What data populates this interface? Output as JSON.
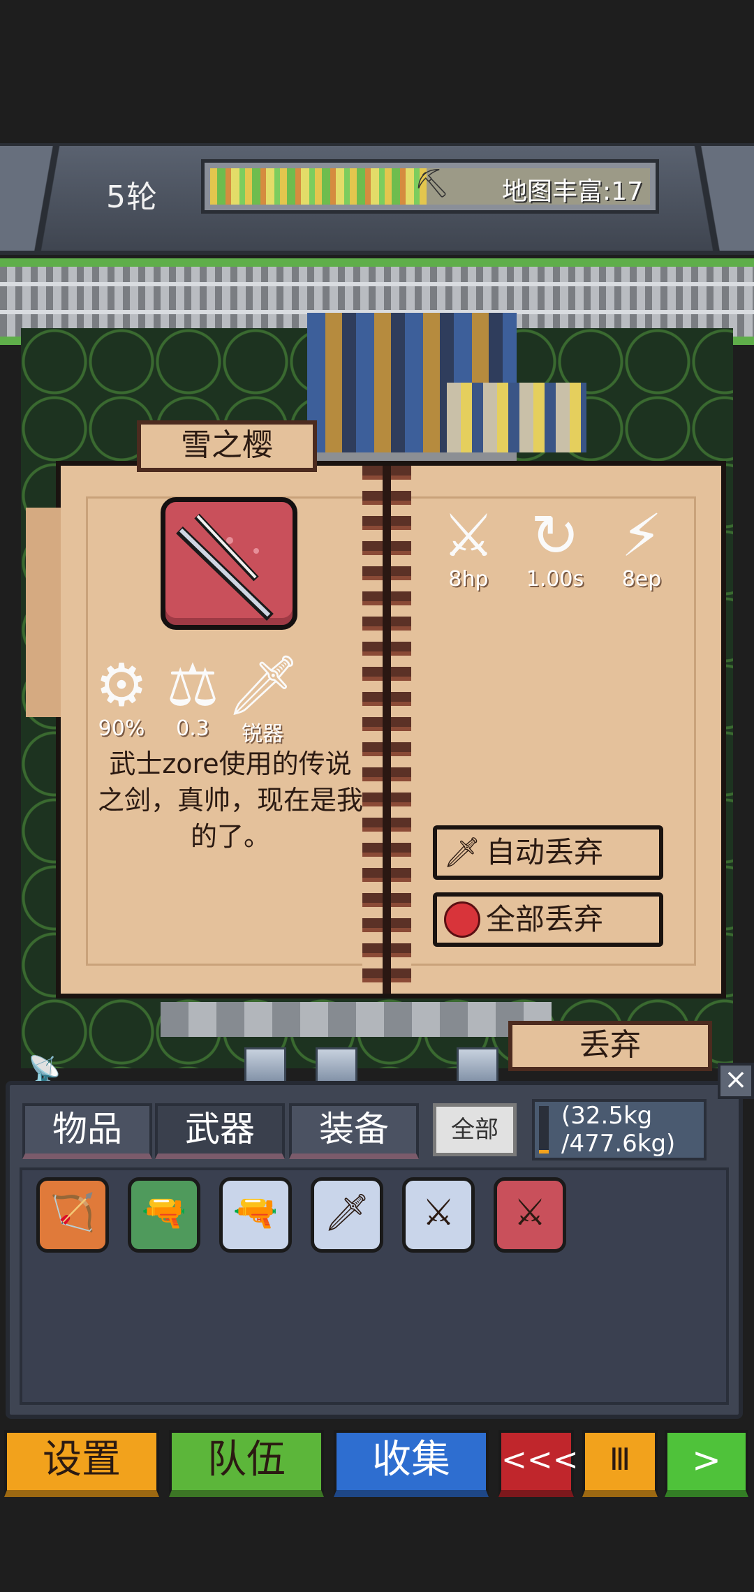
{
  "header": {
    "round_label": "5轮",
    "map_richness_label": "地图丰富:17",
    "richness_marker_icon": "pickaxe-icon"
  },
  "item": {
    "name": "雪之樱",
    "icon": "katana-icon",
    "stats": {
      "damage": "8hp",
      "cooldown": "1.00s",
      "energy": "8ep"
    },
    "stat_icons": [
      "slash-icon",
      "cooldown-icon",
      "energy-icon"
    ],
    "props": {
      "durability": "90%",
      "weight": "0.3",
      "type": "锐器"
    },
    "prop_icons": [
      "gear-icon",
      "weight-icon",
      "dagger-icon"
    ],
    "description": "武士zore使用的传说之剑，真帅，现在是我的了。"
  },
  "actions": {
    "auto_drop": "自动丢弃",
    "drop_all": "全部丢弃",
    "drop": "丢弃"
  },
  "inventory": {
    "tabs": [
      "物品",
      "武器",
      "装备"
    ],
    "filter": "全部",
    "weight_current": "(32.5kg",
    "weight_max": "/477.6kg)",
    "weight_fraction": 0.07,
    "close_icon": "close-icon",
    "items": [
      {
        "icon": "bow-icon",
        "color": "#e07a3a"
      },
      {
        "icon": "rifle-icon",
        "color": "#4f9a5c"
      },
      {
        "icon": "plasma-gun-icon",
        "color": "#c9d5ea"
      },
      {
        "icon": "ice-blade-icon",
        "color": "#c9d5ea"
      },
      {
        "icon": "crystal-sword-icon",
        "color": "#c9d5ea"
      },
      {
        "icon": "katana-icon",
        "color": "#c9505b"
      }
    ]
  },
  "nav": {
    "settings": "设置",
    "team": "队伍",
    "collect": "收集",
    "rewind": "<<<",
    "pause": "Ⅲ",
    "play": ">"
  },
  "colors": {
    "settings": "#f2a21c",
    "team": "#5cb63a",
    "collect": "#2e6ed0",
    "rewind": "#c0262c",
    "pause": "#f2a21c",
    "play": "#4fc23a",
    "parchment": "#e4c19b"
  }
}
